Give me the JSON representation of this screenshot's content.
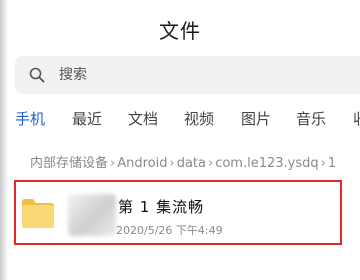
{
  "header": {
    "title": "文件"
  },
  "search": {
    "placeholder": "搜索",
    "value": ""
  },
  "tabs": [
    {
      "label": "手机",
      "active": true
    },
    {
      "label": "最近",
      "active": false
    },
    {
      "label": "文档",
      "active": false
    },
    {
      "label": "视频",
      "active": false
    },
    {
      "label": "图片",
      "active": false
    },
    {
      "label": "音乐",
      "active": false
    },
    {
      "label": "收",
      "active": false
    }
  ],
  "breadcrumb": {
    "items": [
      "内部存储设备",
      "Android",
      "data",
      "com.le123.ysdq",
      "1"
    ]
  },
  "file": {
    "name": "第 1 集流畅",
    "meta": "2020/5/26 下午4:49"
  },
  "colors": {
    "accent": "#1e63c5",
    "highlight_border": "#e0272b",
    "folder": "#f5cd63"
  }
}
